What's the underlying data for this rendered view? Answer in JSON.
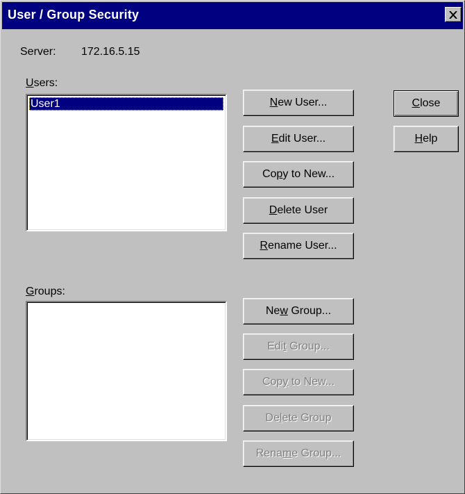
{
  "window": {
    "title": "User / Group Security",
    "close_glyph": "×"
  },
  "server": {
    "label": "Server:",
    "value": "172.16.5.15"
  },
  "users": {
    "label_mnemonic": "U",
    "label_rest": "sers:",
    "items": [
      "User1"
    ],
    "selected_index": 0
  },
  "groups": {
    "label_mnemonic": "G",
    "label_rest": "roups:",
    "items": []
  },
  "user_buttons": [
    {
      "pre": "",
      "key": "N",
      "post": "ew User...",
      "enabled": true
    },
    {
      "pre": "",
      "key": "E",
      "post": "dit User...",
      "enabled": true
    },
    {
      "pre": "Co",
      "key": "p",
      "post": "y to New...",
      "enabled": true
    },
    {
      "pre": "",
      "key": "D",
      "post": "elete User",
      "enabled": true
    },
    {
      "pre": "",
      "key": "R",
      "post": "ename User...",
      "enabled": true
    }
  ],
  "group_buttons": [
    {
      "pre": "Ne",
      "key": "w",
      "post": " Group...",
      "enabled": true
    },
    {
      "pre": "Edi",
      "key": "t",
      "post": " Group...",
      "enabled": false
    },
    {
      "pre": "Cop",
      "key": "y",
      "post": " to New...",
      "enabled": false
    },
    {
      "pre": "De",
      "key": "l",
      "post": "ete Group",
      "enabled": false
    },
    {
      "pre": "Rena",
      "key": "m",
      "post": "e Group...",
      "enabled": false
    }
  ],
  "side_buttons": {
    "close": {
      "pre": "",
      "key": "C",
      "post": "lose"
    },
    "help": {
      "pre": "",
      "key": "H",
      "post": "elp"
    }
  }
}
